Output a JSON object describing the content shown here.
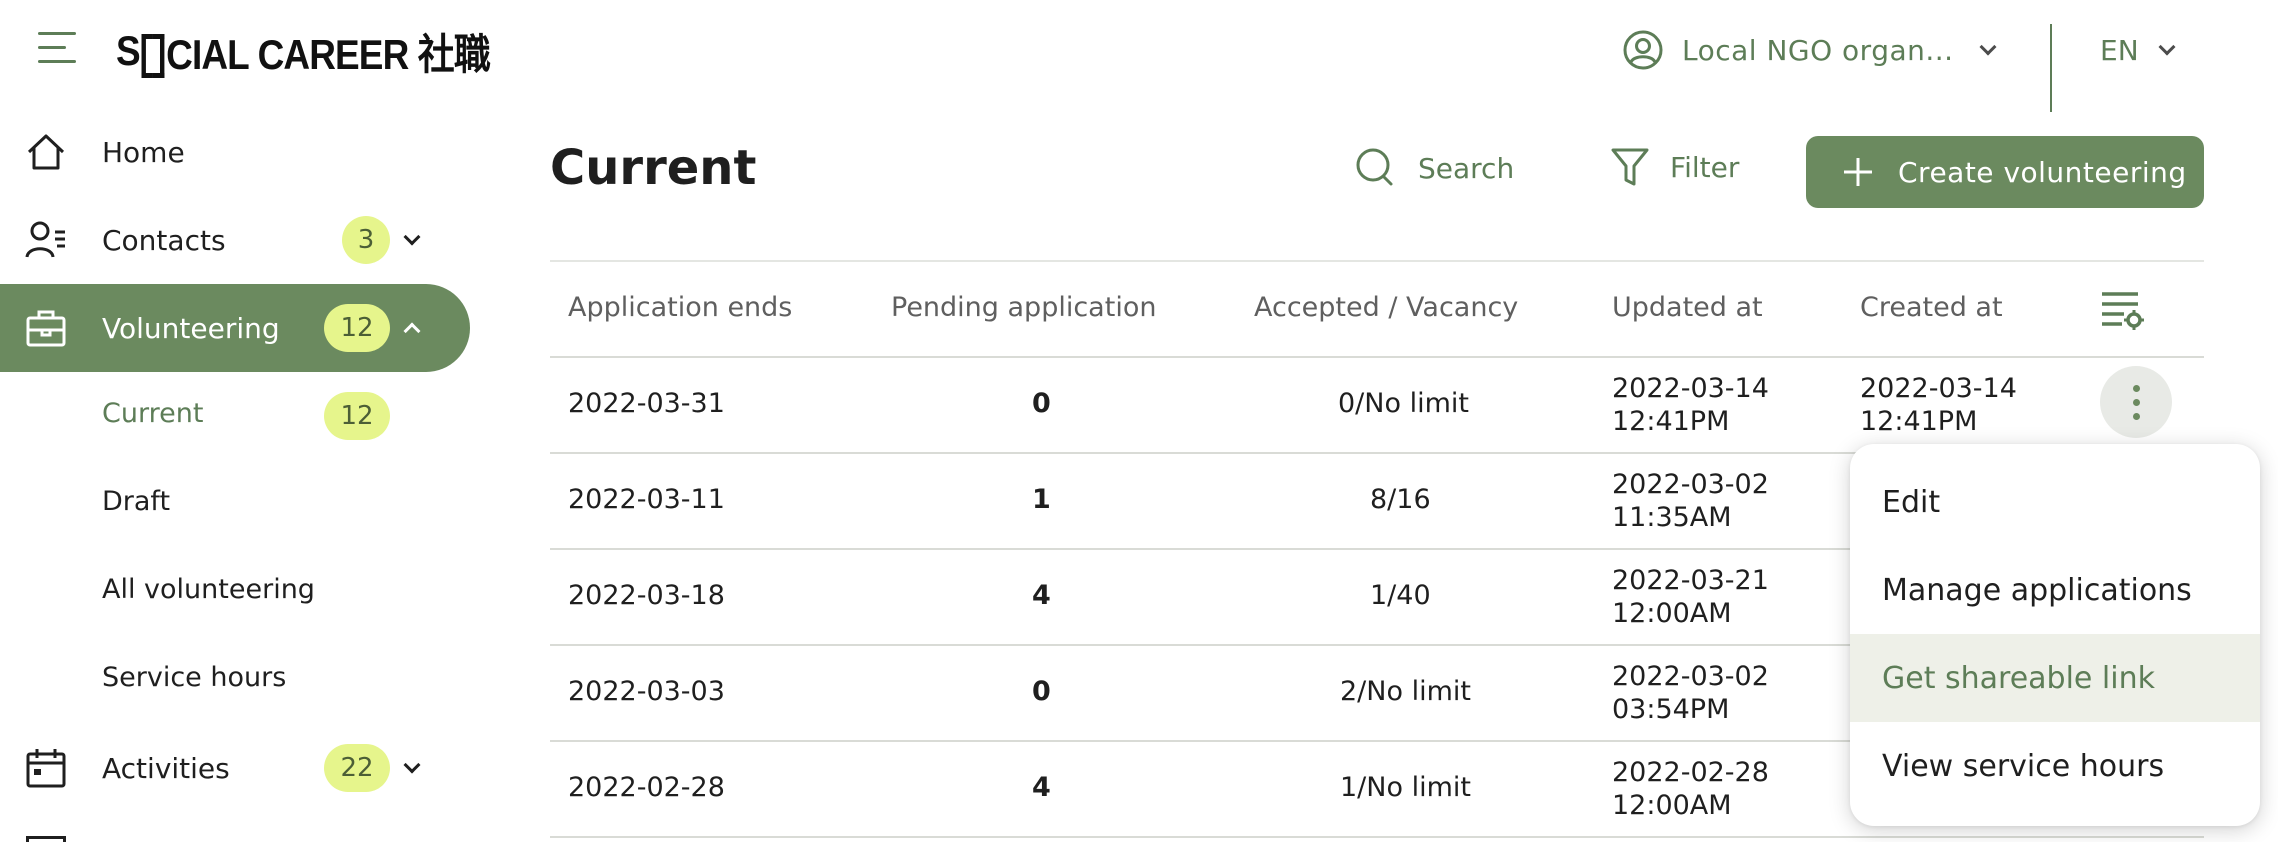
{
  "header": {
    "logo_prefix": "S",
    "logo_suffix": "CIAL CAREER 社職",
    "org_name": "Local NGO organ...",
    "language": "EN"
  },
  "sidebar": {
    "items": [
      {
        "label": "Home"
      },
      {
        "label": "Contacts",
        "badge": "3"
      },
      {
        "label": "Volunteering",
        "badge": "12"
      },
      {
        "label": "Activities",
        "badge": "22"
      }
    ],
    "sub_items": [
      {
        "label": "Current",
        "badge": "12"
      },
      {
        "label": "Draft"
      },
      {
        "label": "All volunteering"
      },
      {
        "label": "Service hours"
      }
    ]
  },
  "main": {
    "title": "Current",
    "search_label": "Search",
    "filter_label": "Filter",
    "create_label": "Create volunteering"
  },
  "table": {
    "columns": [
      "Application ends",
      "Pending application",
      "Accepted / Vacancy",
      "Updated at",
      "Created at"
    ],
    "rows": [
      {
        "ends": "2022-03-31",
        "pending": "0",
        "accepted": "0/No limit",
        "updated_date": "2022-03-14",
        "updated_time": "12:41PM",
        "created_date": "2022-03-14",
        "created_time": "12:41PM"
      },
      {
        "ends": "2022-03-11",
        "pending": "1",
        "accepted": "8/16",
        "updated_date": "2022-03-02",
        "updated_time": "11:35AM"
      },
      {
        "ends": "2022-03-18",
        "pending": "4",
        "accepted": "1/40",
        "updated_date": "2022-03-21",
        "updated_time": "12:00AM"
      },
      {
        "ends": "2022-03-03",
        "pending": "0",
        "accepted": "2/No limit",
        "updated_date": "2022-03-02",
        "updated_time": "03:54PM"
      },
      {
        "ends": "2022-02-28",
        "pending": "4",
        "accepted": "1/No limit",
        "updated_date": "2022-02-28",
        "updated_time": "12:00AM"
      }
    ]
  },
  "menu": {
    "items": [
      {
        "label": "Edit"
      },
      {
        "label": "Manage applications"
      },
      {
        "label": "Get shareable link"
      },
      {
        "label": "View service hours"
      }
    ]
  },
  "colors": {
    "accent": "#6b8a5f",
    "badge": "#e6f58c",
    "menu_highlight": "#eef0e8"
  }
}
